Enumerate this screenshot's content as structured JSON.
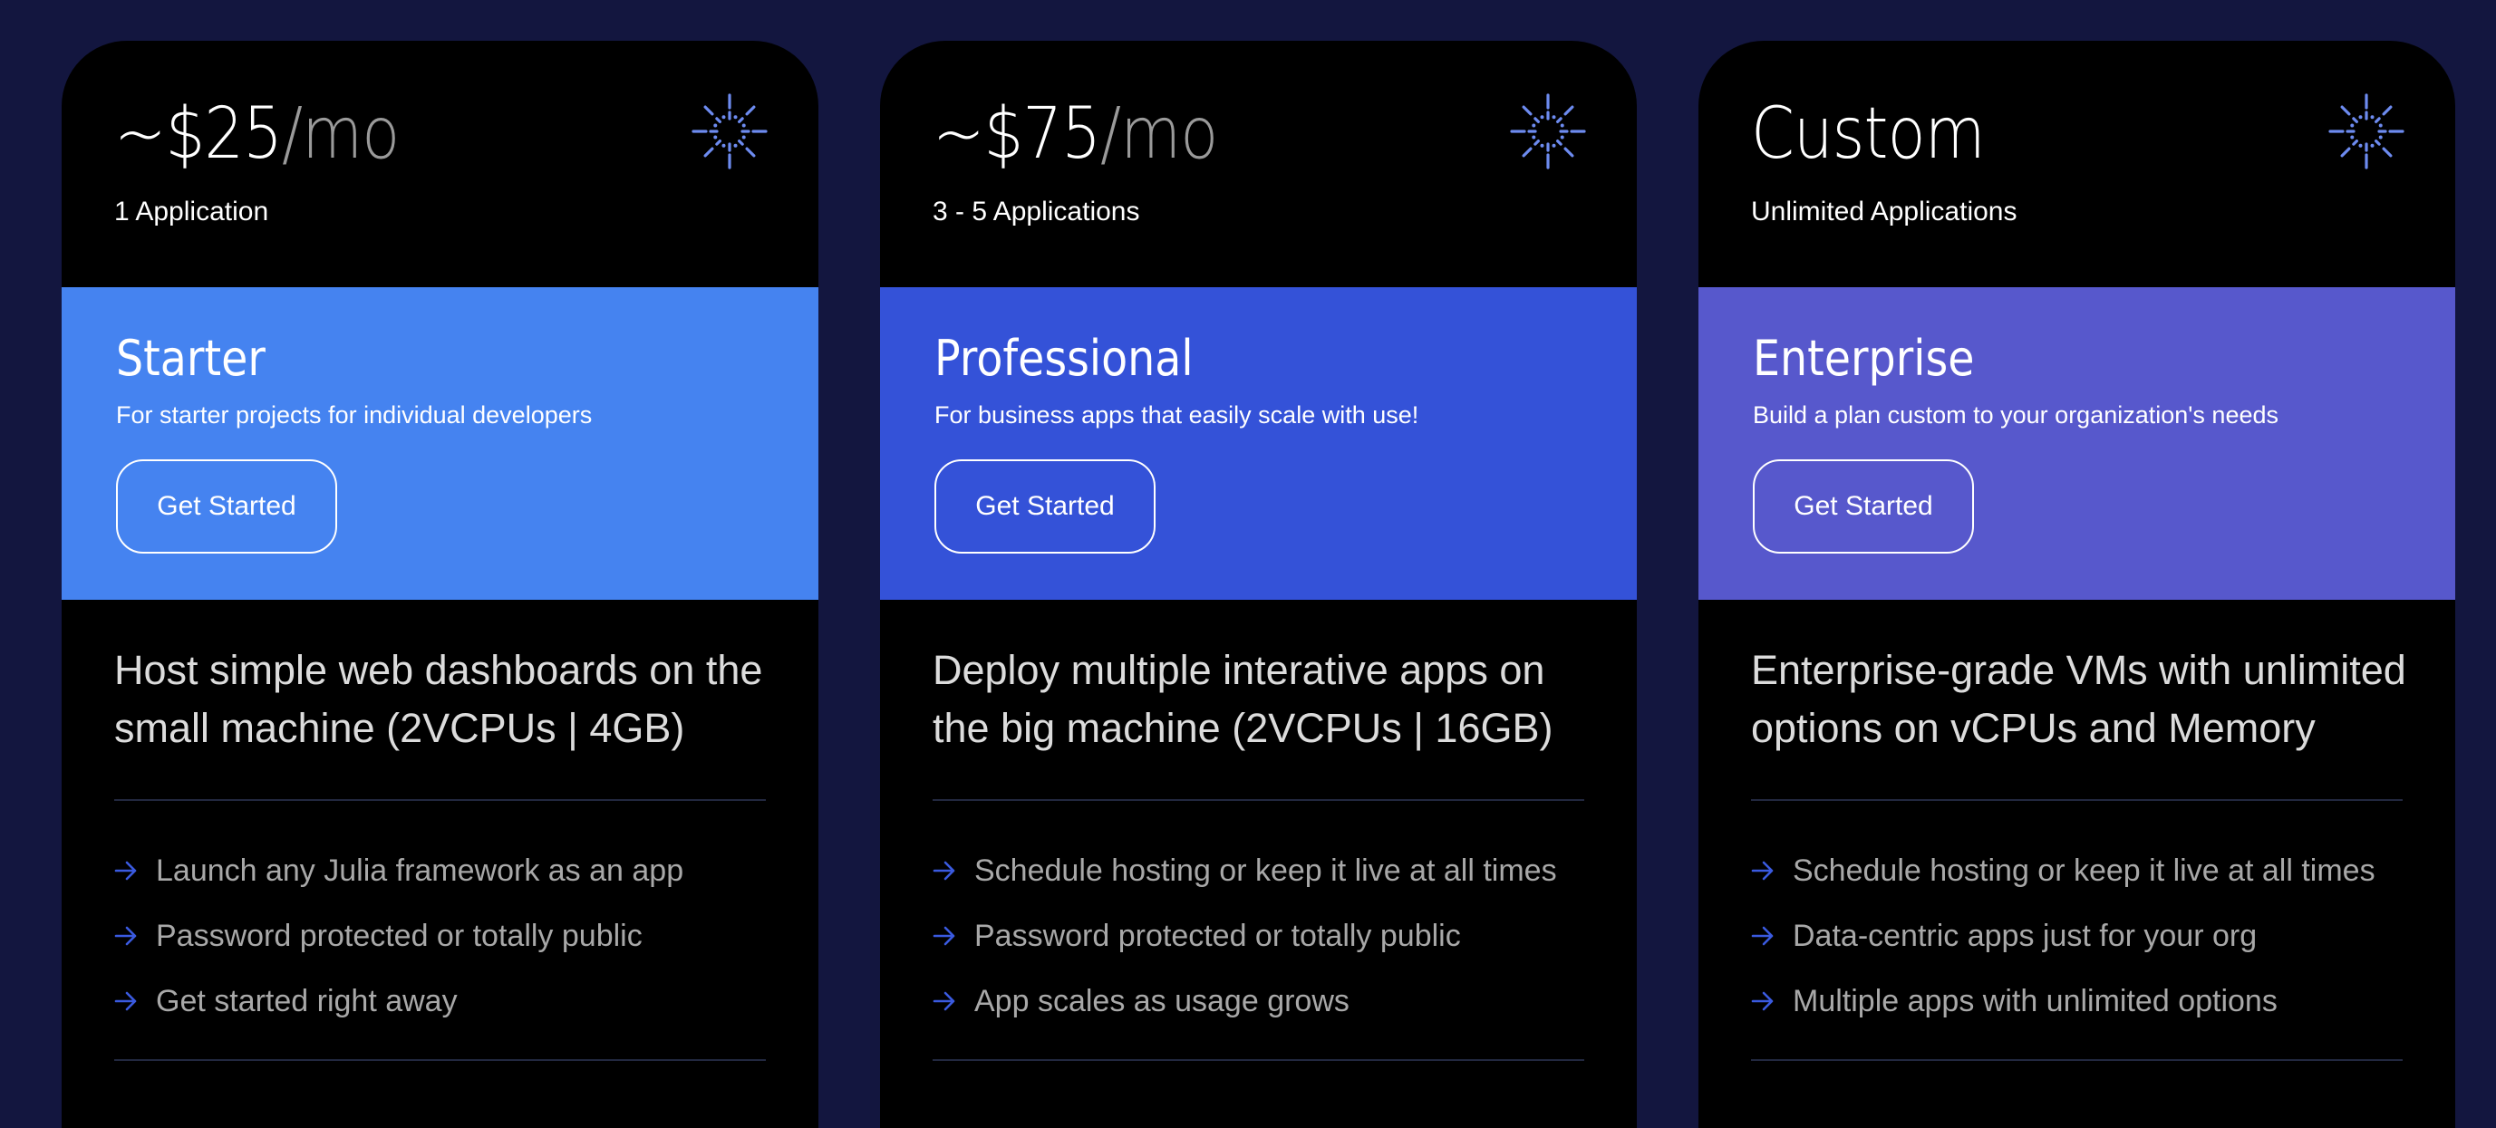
{
  "colors": {
    "page_bg": "#13163f",
    "card_bg": "#000000",
    "icon": "#6d8bf0",
    "arrow": "#3a5ae0",
    "separator": "#222840"
  },
  "plans": [
    {
      "price": "~$25",
      "price_unit": "/mo",
      "apps": "1 Application",
      "icon": "starburst-icon",
      "name": "Starter",
      "description": "For starter projects for individual developers",
      "cta_label": "Get Started",
      "band_color": "#4583f0",
      "summary": "Host simple web dashboards on the small machine (2VCPUs | 4GB)",
      "features": [
        "Launch any Julia framework as an app",
        "Password protected or totally public",
        "Get started right away"
      ]
    },
    {
      "price": "~$75",
      "price_unit": "/mo",
      "apps": "3 - 5 Applications",
      "icon": "starburst-icon",
      "name": "Professional",
      "description": "For business apps that easily scale with use!",
      "cta_label": "Get Started",
      "band_color": "#3452d8",
      "summary": "Deploy multiple interative apps on the big machine (2VCPUs | 16GB)",
      "features": [
        "Schedule hosting or keep it live at all times",
        "Password protected or totally public",
        "App scales as usage grows"
      ]
    },
    {
      "price": "Custom",
      "price_unit": "",
      "apps": "Unlimited Applications",
      "icon": "starburst-icon",
      "name": "Enterprise",
      "description": "Build a plan custom to your organization's needs",
      "cta_label": "Get Started",
      "band_color": "#5758cc",
      "summary": "Enterprise-grade VMs with unlimited options on vCPUs and Memory",
      "features": [
        "Schedule hosting or keep it live at all times",
        "Data-centric apps just for your org",
        "Multiple apps with unlimited options"
      ]
    }
  ]
}
